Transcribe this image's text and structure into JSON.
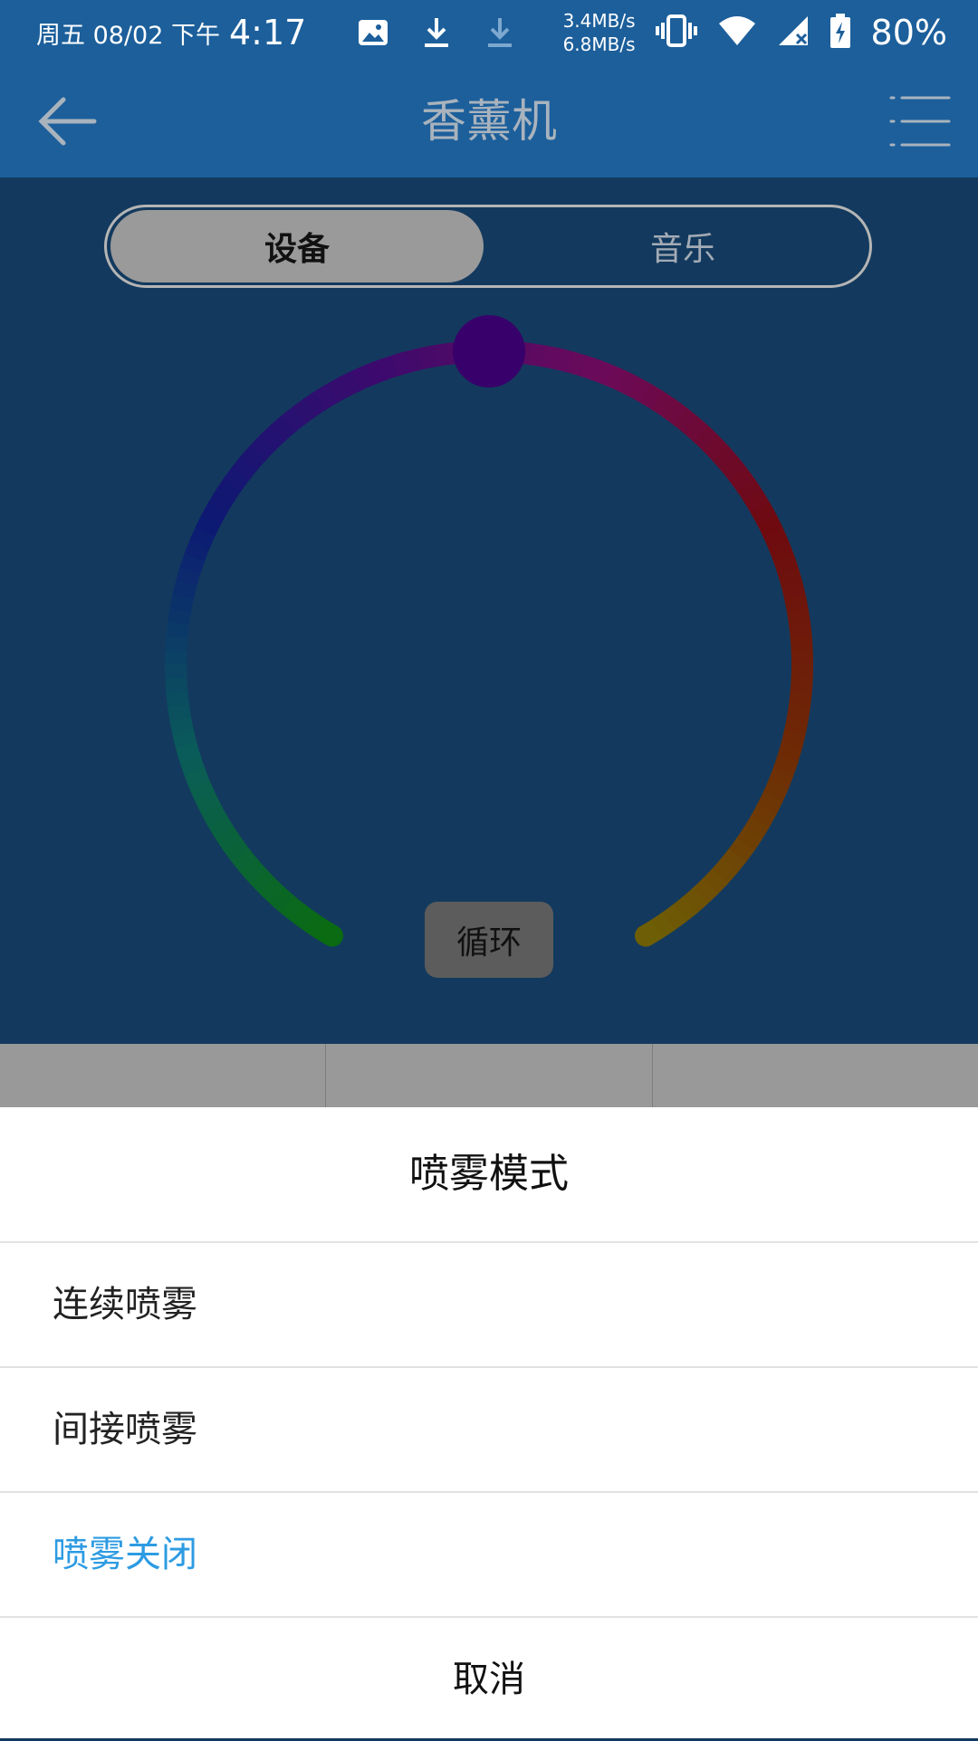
{
  "status_bar": {
    "date": "周五 08/02 下午",
    "time": "4:17",
    "upload_speed": "3.4MB/s",
    "download_speed": "6.8MB/s",
    "battery": "80%",
    "icons": [
      "image-icon",
      "download-icon",
      "download-faded-icon",
      "vibrate-icon",
      "wifi-icon",
      "signal-icon",
      "battery-charging-icon"
    ]
  },
  "app_bar": {
    "title": "香薰机",
    "back_icon": "arrow-left-icon",
    "menu_icon": "list-menu-icon"
  },
  "segments": {
    "device": "设备",
    "music": "音乐",
    "selected": "device"
  },
  "color_wheel": {
    "mode_label": "循环",
    "ring_colors": [
      "#0a6b12",
      "#0a5c5a",
      "#0c1a73",
      "#3c0a6e",
      "#6c0a5a",
      "#6e0a10",
      "#6e2a05",
      "#6e5e05"
    ]
  },
  "sheet": {
    "title": "喷雾模式",
    "options": [
      {
        "label": "连续喷雾",
        "selected": false
      },
      {
        "label": "间接喷雾",
        "selected": false
      },
      {
        "label": "喷雾关闭",
        "selected": true
      }
    ],
    "cancel": "取消",
    "accent": "#2d9be2"
  }
}
